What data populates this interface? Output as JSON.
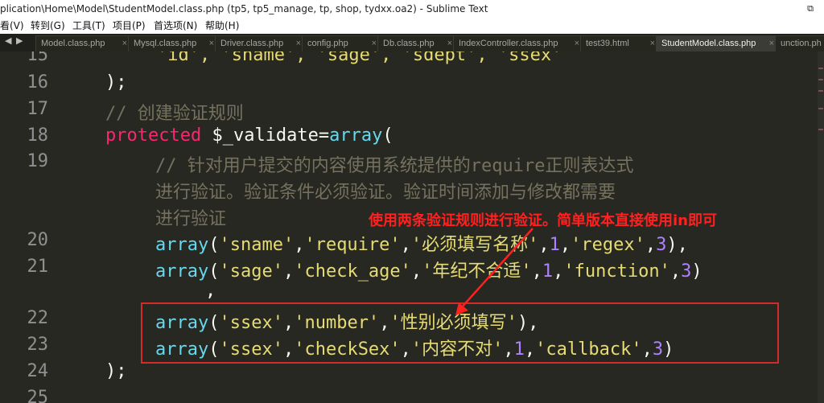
{
  "window": {
    "title": "plication\\Home\\Model\\StudentModel.class.php (tp5, tp5_manage, tp, shop, tydxx.oa2) - Sublime Text",
    "restore_glyph": "⧉"
  },
  "menu": [
    "看(V)",
    "转到(G)",
    "工具(T)",
    "项目(P)",
    "首选项(N)",
    "帮助(H)"
  ],
  "tabs": {
    "nav": "◀ ▶",
    "items": [
      {
        "label": "Model.class.php",
        "active": false
      },
      {
        "label": "Mysql.class.php",
        "active": false
      },
      {
        "label": "Driver.class.php",
        "active": false
      },
      {
        "label": "config.php",
        "active": false
      },
      {
        "label": "Db.class.php",
        "active": false
      },
      {
        "label": "IndexController.class.php",
        "active": false
      },
      {
        "label": "test39.html",
        "active": false
      },
      {
        "label": "StudentModel.class.php",
        "active": true
      },
      {
        "label": "unction.ph",
        "active": false
      }
    ],
    "close_glyph": "×"
  },
  "editor": {
    "line_numbers": [
      "15",
      "16",
      "17",
      "18",
      "19",
      "20",
      "21",
      "22",
      "23",
      "24",
      "25"
    ],
    "lines": {
      "l15": {
        "t1": "'id', 'sname', 'sage', 'sdept', 'ssex'"
      },
      "l16": {
        "t1": ");"
      },
      "l17": {
        "t1": "// 创建验证规则"
      },
      "l18": {
        "t1": "protected",
        "t2": " $_validate=",
        "t3": "array",
        "t4": "("
      },
      "l19a": {
        "t1": "// 针对用户提交的内容使用系统提供的require正则表达式"
      },
      "l19b": {
        "t1": "进行验证。验证条件必须验证。验证时间添加与修改都需要"
      },
      "l19c": {
        "t1": "进行验证"
      },
      "l20": {
        "t1": "array",
        "t2": "(",
        "t3": "'sname'",
        "t4": ",",
        "t5": "'require'",
        "t6": ",",
        "t7": "'必须填写名称'",
        "t8": ",",
        "t9": "1",
        "t10": ",",
        "t11": "'regex'",
        "t12": ",",
        "t13": "3",
        "t14": "),"
      },
      "l21": {
        "t1": "array",
        "t2": "(",
        "t3": "'sage'",
        "t4": ",",
        "t5": "'check_age'",
        "t6": ",",
        "t7": "'年纪不合适'",
        "t8": ",",
        "t9": "1",
        "t10": ",",
        "t11": "'function'",
        "t12": ",",
        "t13": "3",
        "t14": ")"
      },
      "l21b": {
        "t1": ","
      },
      "l22": {
        "t1": "array",
        "t2": "(",
        "t3": "'ssex'",
        "t4": ",",
        "t5": "'number'",
        "t6": ",",
        "t7": "'性别必须填写'",
        "t8": "),"
      },
      "l23": {
        "t1": "array",
        "t2": "(",
        "t3": "'ssex'",
        "t4": ",",
        "t5": "'checkSex'",
        "t6": ",",
        "t7": "'内容不对'",
        "t8": ",",
        "t9": "1",
        "t10": ",",
        "t11": "'callback'",
        "t12": ",",
        "t13": "3",
        "t14": ")"
      },
      "l24": {
        "t1": ");"
      }
    }
  },
  "annotation": {
    "text": "使用两条验证规则进行验证。简单版本直接使用in即可",
    "color": "#ff2020"
  },
  "colors": {
    "background": "#272822",
    "keyword": "#f92672",
    "function": "#66d9ef",
    "string": "#e6db74",
    "number": "#ae81ff",
    "comment": "#75715e",
    "box": "#d42a2a"
  }
}
